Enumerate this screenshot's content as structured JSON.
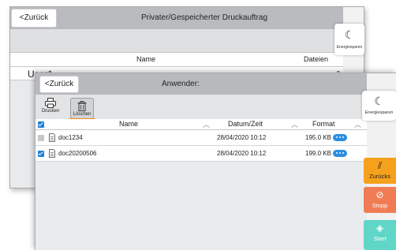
{
  "back_screen": {
    "back_label": "<Zurück",
    "title": "Privater/Gespeicherter Druckauftrag",
    "columns": {
      "name": "Name",
      "files": "Dateien"
    },
    "row": {
      "user": "User1",
      "count": "2"
    },
    "energy_label": "Energiesparen"
  },
  "front_screen": {
    "back_label": "<Zurück",
    "title": "Anwender:",
    "toolbar": {
      "print_label": "Drucken",
      "delete_label": "Löschen"
    },
    "columns": {
      "name": "Name",
      "datetime": "Datum/Zeit",
      "format": "Format"
    },
    "rows": [
      {
        "name": "doc1234",
        "datetime": "28/04/2020 10:12",
        "size": "195.0 KB",
        "checked": false
      },
      {
        "name": "doc20200506",
        "datetime": "28/04/2020 10:12",
        "size": "199.0 KB",
        "checked": true
      }
    ],
    "energy_label": "Energiesparen"
  },
  "side_buttons": {
    "reset_label": "Zurücks",
    "stop_label": "Stopp",
    "start_label": "Start"
  },
  "colors": {
    "highlight": "#f08a1d",
    "checkbox": "#1e7fd7",
    "reset": "#f6a11c",
    "stop": "#f07c55",
    "start": "#5fd6c7"
  },
  "icons": [
    "printer-icon",
    "trash-icon",
    "moon-icon",
    "document-icon",
    "more-dots-icon",
    "reset-icon",
    "stop-icon",
    "start-icon",
    "sort-arrow-icon",
    "checkmark-icon"
  ]
}
